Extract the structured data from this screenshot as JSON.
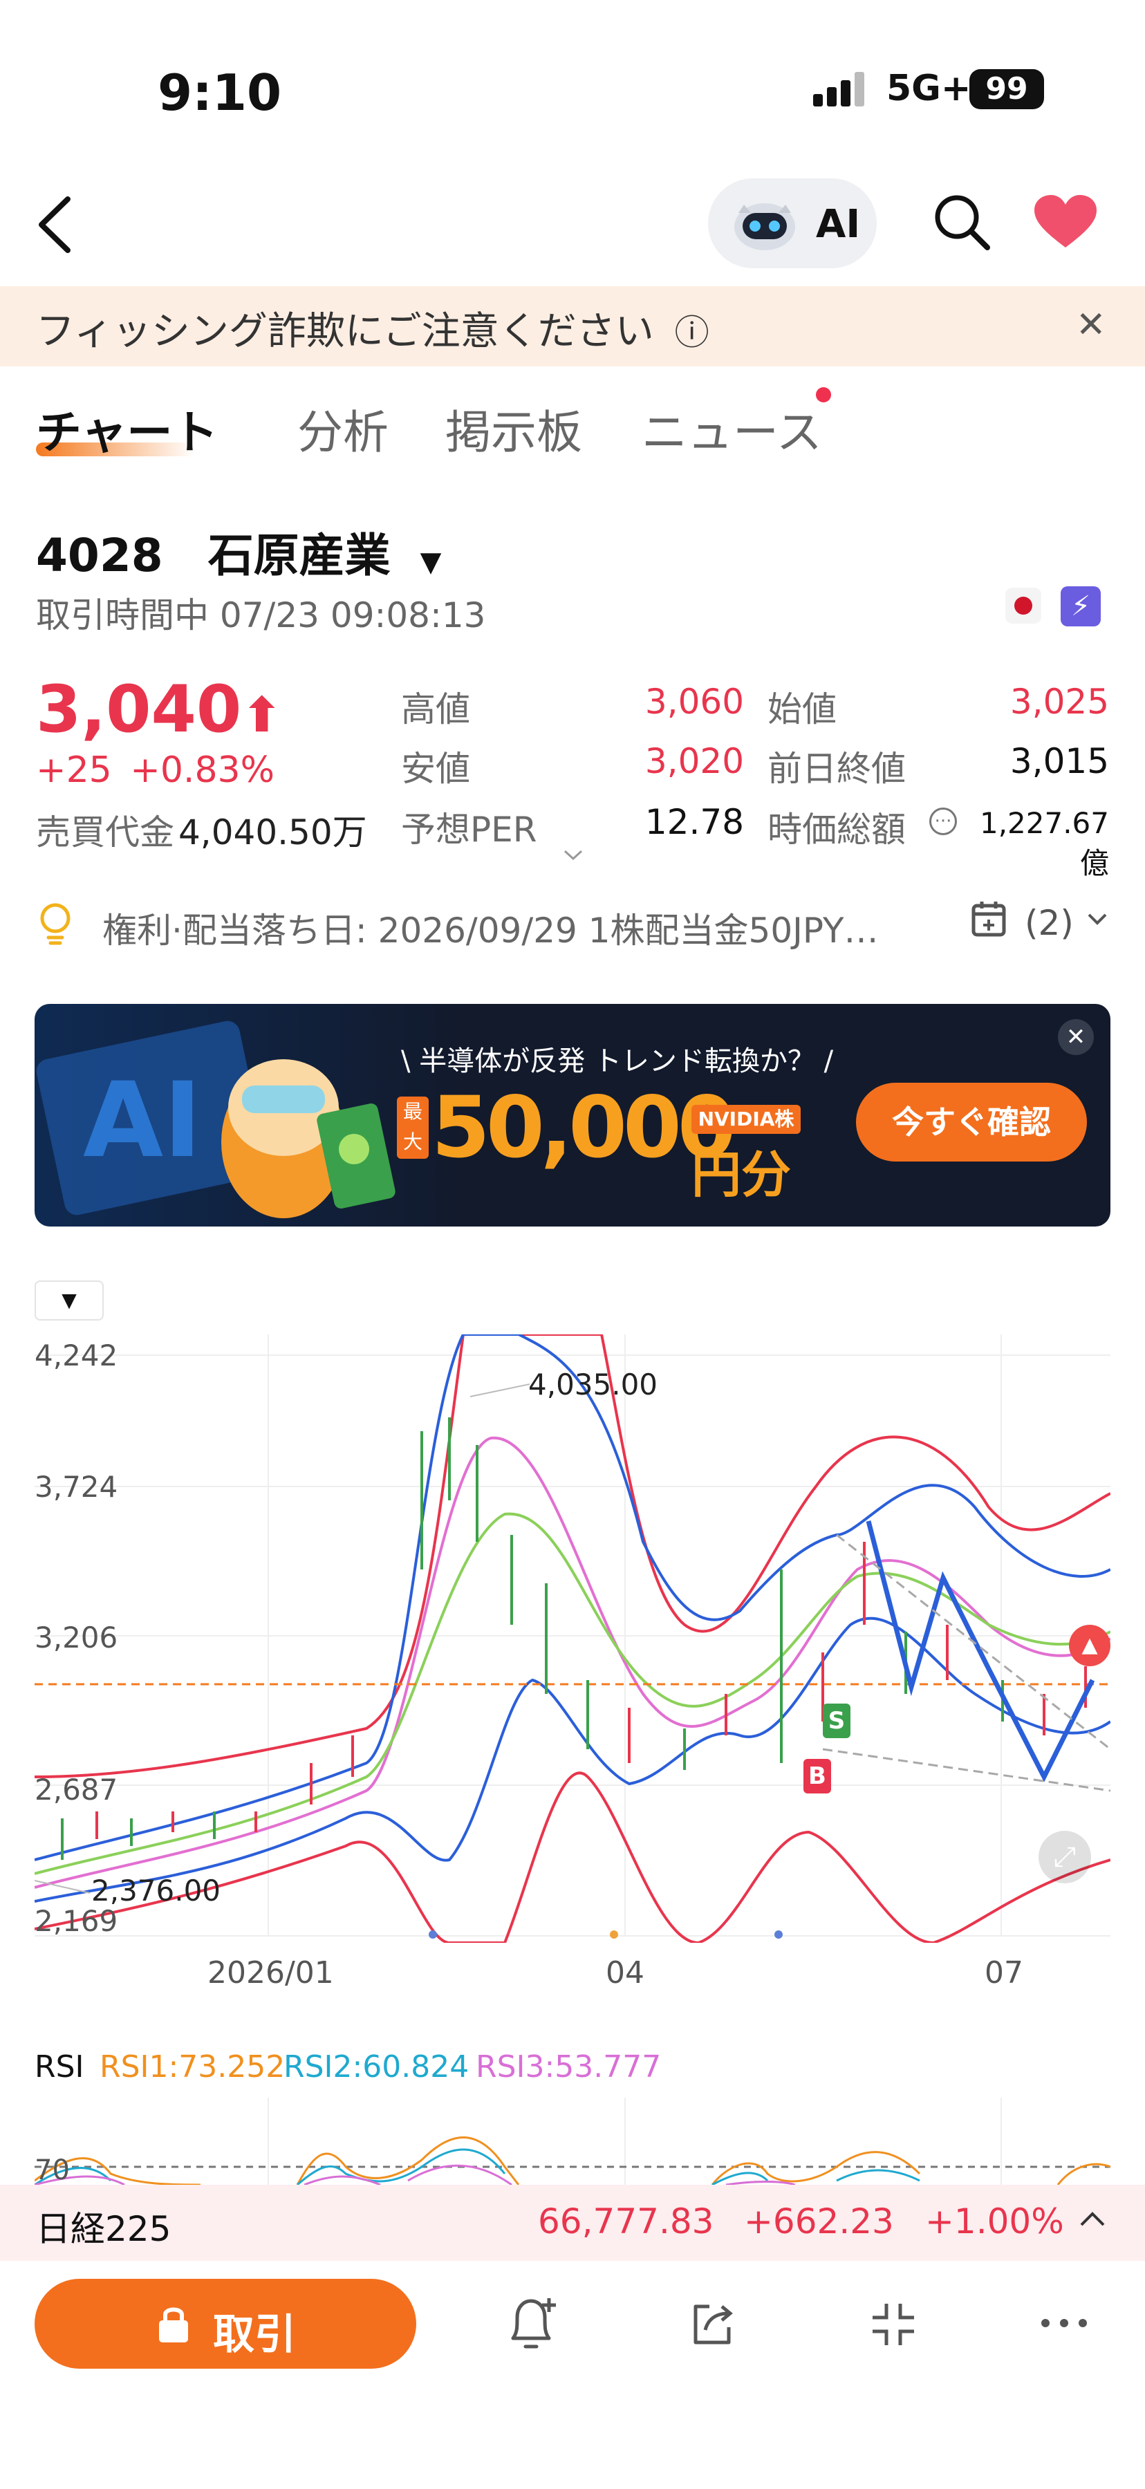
{
  "status_bar": {
    "time": "9:10",
    "network": "5G+",
    "battery": "99"
  },
  "header": {
    "ai_label": "AI"
  },
  "warning": {
    "text": "フィッシング詐欺にご注意ください",
    "info_glyph": "ⓘ",
    "close_glyph": "✕"
  },
  "tabs": [
    {
      "label": "チャート",
      "active": true
    },
    {
      "label": "分析"
    },
    {
      "label": "掲示板"
    },
    {
      "label": "ニュース",
      "badge": true
    }
  ],
  "stock": {
    "code": "4028",
    "name": "石原産業",
    "status": "取引時間中 07/23 09:08:13",
    "price": "3,040",
    "change": "+25",
    "change_pct": "+0.83%",
    "turnover_label": "売買代金",
    "turnover": "4,040.50万",
    "stats": {
      "high_label": "高値",
      "high": "3,060",
      "open_label": "始値",
      "open": "3,025",
      "low_label": "安値",
      "low": "3,020",
      "prev_close_label": "前日終値",
      "prev_close": "3,015",
      "per_label": "予想PER",
      "per": "12.78",
      "mcap_label": "時価総額",
      "mcap": "1,227.67億"
    }
  },
  "dividend": {
    "text": "権利·配当落ち日: 2026/09/29 1株配当金50JPY…",
    "count": "(2)"
  },
  "banner": {
    "headline": "\\ 半導体が反発 トレンド転換か？ /",
    "amount_prefix": "最大",
    "amount": "50,000",
    "amount_suffix": "円分",
    "nvidia_tag": "NVIDIA株",
    "cta": "今すぐ確認"
  },
  "chart": {
    "y_ticks": [
      "4,242",
      "3,724",
      "3,206",
      "2,687",
      "2,169"
    ],
    "x_ticks": [
      "2026/01",
      "04",
      "07"
    ],
    "high_annotation": "4,035.00",
    "low_annotation": "2,376.00",
    "buy_marker": "B",
    "sell_marker": "S",
    "colors": {
      "upper": "#e8354d",
      "mid": "#2b5fd9",
      "ma": "#e26fd1",
      "green": "#8bd05a",
      "last_price": "#f47a1f"
    }
  },
  "rsi": {
    "title": "RSI",
    "rsi1": "RSI1:73.252",
    "rsi2": "RSI2:60.824",
    "rsi3": "RSI3:53.777",
    "level": "70",
    "colors": {
      "rsi1": "#f0901f",
      "rsi2": "#1fa9cf",
      "rsi3": "#d86fd6"
    }
  },
  "nikkei": {
    "name": "日経225",
    "value": "66,777.83",
    "change": "+662.23",
    "pct": "+1.00%"
  },
  "bottom_bar": {
    "trade_label": "取引"
  }
}
